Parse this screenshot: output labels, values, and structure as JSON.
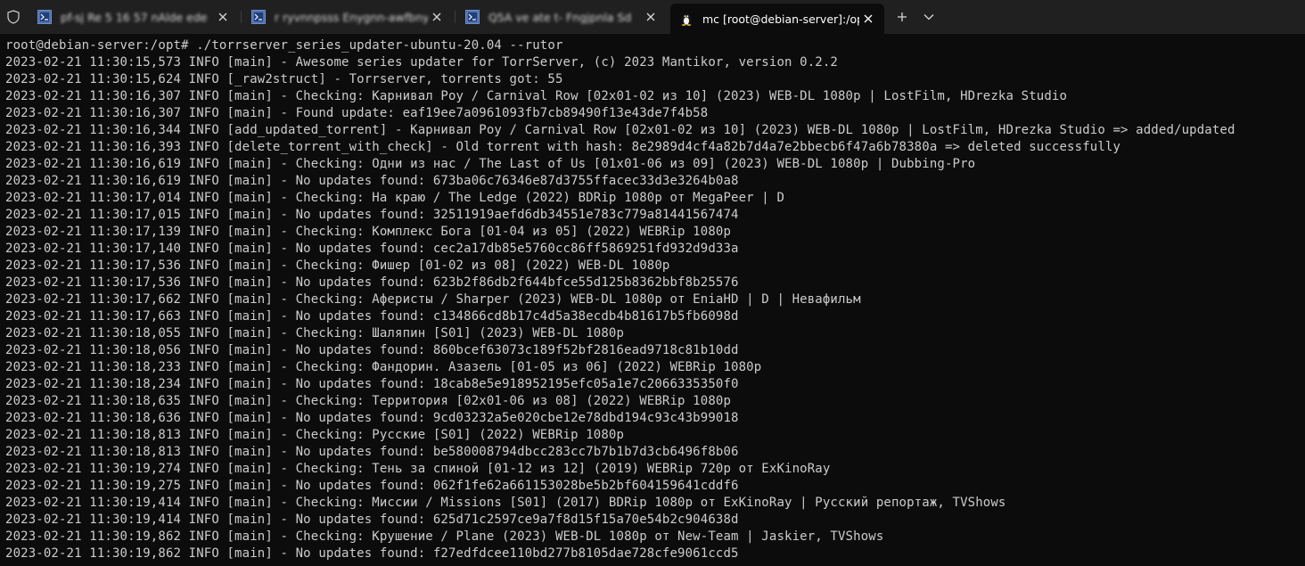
{
  "tabs": [
    {
      "label": "pf-sj  Re 5 16 57  nAlde ede",
      "icon": "powershell-icon",
      "active": false
    },
    {
      "label": "r  ryvnnpsss  Enygnn-awfbnyys",
      "icon": "powershell-icon",
      "active": false
    },
    {
      "label": "Q5A ve ate  t-  Fngjpnla Sd",
      "icon": "powershell-icon",
      "active": false
    },
    {
      "label": "mc [root@debian-server]:/opt",
      "icon": "linux-tux-icon",
      "active": true
    }
  ],
  "tabbar": {
    "new_tab_icon": "plus-icon",
    "dropdown_icon": "chevron-down-icon",
    "close_icon": "close-icon",
    "shield_icon": "shield-icon"
  },
  "colors": {
    "terminal_bg": "#0c0c0c",
    "terminal_fg": "#cccccc",
    "tabbar_bg": "#202020",
    "active_tab_bg": "#0c0c0c",
    "ps_icon_blue": "#2a5caa"
  },
  "terminal": {
    "lines": [
      "root@debian-server:/opt# ./torrserver_series_updater-ubuntu-20.04 --rutor",
      "2023-02-21 11:30:15,573 INFO [main] - Awesome series updater for TorrServer, (c) 2023 Mantikor, version 0.2.2",
      "2023-02-21 11:30:15,624 INFO [_raw2struct] - Torrserver, torrents got: 55",
      "2023-02-21 11:30:16,307 INFO [main] - Checking: Карнивал Роу / Carnival Row [02x01-02 из 10] (2023) WEB-DL 1080p | LostFilm, HDrezka Studio",
      "2023-02-21 11:30:16,307 INFO [main] - Found update: eaf19ee7a0961093fb7cb89490f13e43de7f4b58",
      "2023-02-21 11:30:16,344 INFO [add_updated_torrent] - Карнивал Роу / Carnival Row [02x01-02 из 10] (2023) WEB-DL 1080p | LostFilm, HDrezka Studio => added/updated",
      "2023-02-21 11:30:16,393 INFO [delete_torrent_with_check] - Old torrent with hash: 8e2989d4cf4a82b7d4a7e2bbecb6f47a6b78380a => deleted successfully",
      "2023-02-21 11:30:16,619 INFO [main] - Checking: Одни из нас / The Last of Us [01x01-06 из 09] (2023) WEB-DL 1080p | Dubbing-Pro",
      "2023-02-21 11:30:16,619 INFO [main] - No updates found: 673ba06c76346e87d3755ffacec33d3e3264b0a8",
      "2023-02-21 11:30:17,014 INFO [main] - Checking: На краю / The Ledge (2022) BDRip 1080p от MegaPeer | D",
      "2023-02-21 11:30:17,015 INFO [main] - No updates found: 32511919aefd6db34551e783c779a81441567474",
      "2023-02-21 11:30:17,139 INFO [main] - Checking: Комплекс Бога [01-04 из 05] (2022) WEBRip 1080p",
      "2023-02-21 11:30:17,140 INFO [main] - No updates found: cec2a17db85e5760cc86ff5869251fd932d9d33a",
      "2023-02-21 11:30:17,536 INFO [main] - Checking: Фишер [01-02 из 08] (2022) WEB-DL 1080p",
      "2023-02-21 11:30:17,536 INFO [main] - No updates found: 623b2f86db2f644bfce55d125b8362bbf8b25576",
      "2023-02-21 11:30:17,662 INFO [main] - Checking: Аферисты / Sharper (2023) WEB-DL 1080p от EniaHD | D | Невафильм",
      "2023-02-21 11:30:17,663 INFO [main] - No updates found: c134866cd8b17c4d5a38ecdb4b81617b5fb6098d",
      "2023-02-21 11:30:18,055 INFO [main] - Checking: Шаляпин [S01] (2023) WEB-DL 1080p",
      "2023-02-21 11:30:18,056 INFO [main] - No updates found: 860bcef63073c189f52bf2816ead9718c81b10dd",
      "2023-02-21 11:30:18,233 INFO [main] - Checking: Фандорин. Азазель [01-05 из 06] (2022) WEBRip 1080p",
      "2023-02-21 11:30:18,234 INFO [main] - No updates found: 18cab8e5e918952195efc05a1e7c2066335350f0",
      "2023-02-21 11:30:18,635 INFO [main] - Checking: Территория [02x01-06 из 08] (2022) WEBRip 1080p",
      "2023-02-21 11:30:18,636 INFO [main] - No updates found: 9cd03232a5e020cbe12e78dbd194c93c43b99018",
      "2023-02-21 11:30:18,813 INFO [main] - Checking: Русские [S01] (2022) WEBRip 1080p",
      "2023-02-21 11:30:18,813 INFO [main] - No updates found: be580008794dbcc283cc7b7b1b7d3cb6496f8b06",
      "2023-02-21 11:30:19,274 INFO [main] - Checking: Тень за спиной [01-12 из 12] (2019) WEBRip 720p от ExKinoRay",
      "2023-02-21 11:30:19,275 INFO [main] - No updates found: 062f1fe62a661153028be5b2bf604159641cddf6",
      "2023-02-21 11:30:19,414 INFO [main] - Checking: Миссии / Missions [S01] (2017) BDRip 1080p от ExKinoRay | Русский репортаж, TVShows",
      "2023-02-21 11:30:19,414 INFO [main] - No updates found: 625d71c2597ce9a7f8d15f15a70e54b2c904638d",
      "2023-02-21 11:30:19,862 INFO [main] - Checking: Крушение / Plane (2023) WEB-DL 1080p от New-Team | Jaskier, TVShows",
      "2023-02-21 11:30:19,862 INFO [main] - No updates found: f27edfdcee110bd277b8105dae728cfe9061ccd5"
    ]
  }
}
